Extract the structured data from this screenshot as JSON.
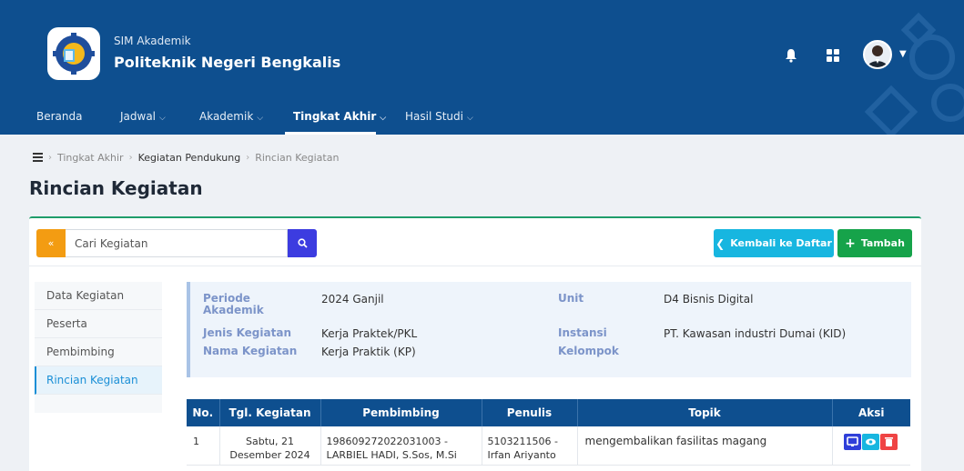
{
  "header": {
    "app_subtitle": "SIM Akademik",
    "app_title": "Politeknik Negeri Bengkalis",
    "brand_color": "#0e4f8f"
  },
  "nav": {
    "items": [
      {
        "label": "Beranda",
        "dropdown": false
      },
      {
        "label": "Jadwal",
        "dropdown": true
      },
      {
        "label": "Akademik",
        "dropdown": true
      },
      {
        "label": "Tingkat Akhir",
        "dropdown": true,
        "active": true
      },
      {
        "label": "Hasil Studi",
        "dropdown": true
      }
    ]
  },
  "breadcrumb": {
    "items": [
      "Tingkat Akhir",
      "Kegiatan Pendukung",
      "Rincian Kegiatan"
    ]
  },
  "page": {
    "title": "Rincian Kegiatan"
  },
  "toolbar": {
    "search_placeholder": "Cari Kegiatan",
    "back_label": "Kembali ke Daftar",
    "add_label": "Tambah"
  },
  "side_menu": {
    "items": [
      {
        "label": "Data Kegiatan"
      },
      {
        "label": "Peserta"
      },
      {
        "label": "Pembimbing"
      },
      {
        "label": "Rincian Kegiatan",
        "active": true
      }
    ]
  },
  "info": {
    "periode_label": "Periode Akademik",
    "periode_value": "2024 Ganjil",
    "jenis_label": "Jenis Kegiatan",
    "jenis_value": "Kerja Praktek/PKL",
    "nama_label": "Nama Kegiatan",
    "nama_value": "Kerja Praktik (KP)",
    "unit_label": "Unit",
    "unit_value": "D4 Bisnis Digital",
    "instansi_label": "Instansi",
    "instansi_value": "PT. Kawasan industri Dumai (KID)",
    "kelompok_label": "Kelompok",
    "kelompok_value": ""
  },
  "table": {
    "headers": [
      "No.",
      "Tgl. Kegiatan",
      "Pembimbing",
      "Penulis",
      "Topik",
      "Aksi"
    ],
    "rows": [
      {
        "no": "1",
        "tgl_line1": "Sabtu, 21",
        "tgl_line2": "Desember 2024",
        "pembimbing_line1": "198609272022031003 -",
        "pembimbing_line2": "LARBIEL HADI, S.Sos, M.Si",
        "penulis_line1": "5103211506 -",
        "penulis_line2": "Irfan Ariyanto",
        "topik": "mengembalikan fasilitas magang"
      }
    ]
  }
}
